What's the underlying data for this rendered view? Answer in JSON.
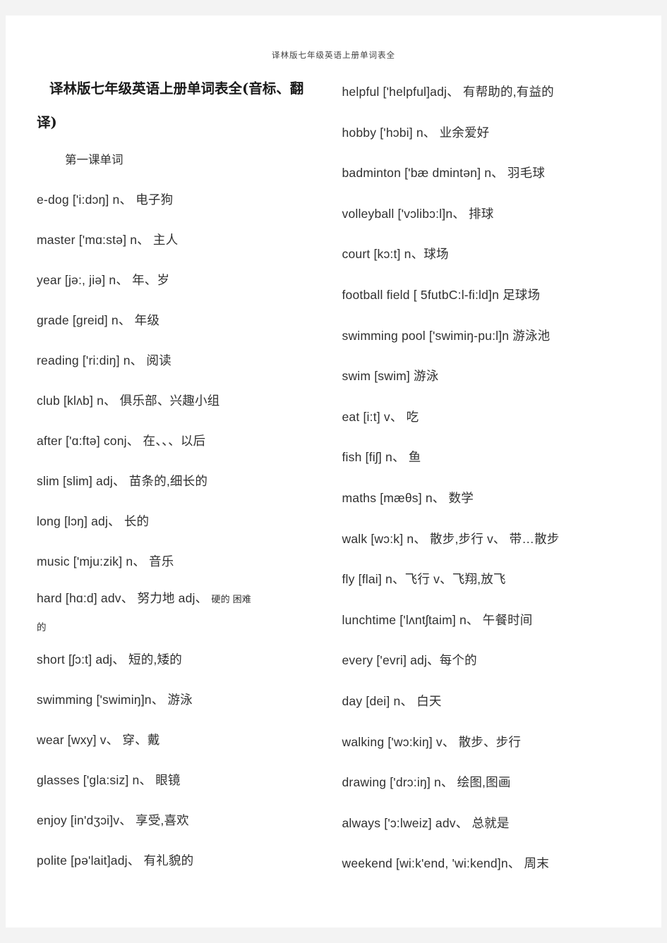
{
  "page": {
    "running_header": "译林版七年级英语上册单词表全",
    "title": "译林版七年级英语上册单词表全(音标、翻译)",
    "section_heading": "第一课单词"
  },
  "left_column": {
    "entries": [
      "e-dog ['i:dɔŋ] n、 电子狗",
      "master ['mɑ:stə] n、 主人",
      "year [jə:, jiə] n、 年、岁",
      "grade [greid] n、 年级",
      "reading ['ri:diŋ] n、 阅读",
      "club [klʌb] n、 俱乐部、兴趣小组",
      "after ['ɑ:ftə] conj、 在、、、以后",
      "slim [slim] adj、 苗条的,细长的",
      "long [lɔŋ] adj、 长的",
      "music ['mju:zik] n、 音乐"
    ],
    "hard_entry": {
      "main": "hard [hɑ:d] adv、 努力地 adj、 ",
      "tail": "硬的 困难",
      "continuation": "的"
    },
    "entries_after": [
      "short [ʃɔ:t] adj、 短的,矮的",
      "swimming ['swimiŋ]n、 游泳",
      "wear [wxy] v、 穿、戴",
      "glasses ['gla:siz] n、 眼镜",
      "enjoy [in'dʒɔi]v、 享受,喜欢",
      "polite [pə'lait]adj、 有礼貌的"
    ]
  },
  "right_column": {
    "entries": [
      "helpful ['helpful]adj、 有帮助的,有益的",
      "hobby ['hɔbi] n、 业余爱好",
      "badminton ['bæ dmintən] n、 羽毛球",
      "volleyball ['vɔlibɔ:l]n、 排球",
      "court [kɔ:t] n、球场",
      "football field [ 5futbC:l-fi:ld]n 足球场",
      "swimming pool ['swimiŋ-pu:l]n 游泳池",
      "swim [swim] 游泳",
      "eat [i:t] v、 吃",
      "fish [fiʃ] n、 鱼",
      "maths [mæθs] n、 数学",
      "walk [wɔ:k] n、 散步,步行 v、 带…散步",
      "fly [flai] n、飞行 v、飞翔,放飞",
      "lunchtime ['lʌntʃtaim] n、 午餐时间",
      "every ['evri] adj、每个的",
      "day [dei] n、 白天",
      "walking ['wɔ:kiŋ] v、 散步、步行",
      "drawing ['drɔ:iŋ] n、 绘图,图画",
      "always ['ɔ:lweiz] adv、 总就是",
      "weekend [wi:k'end, 'wi:kend]n、 周末"
    ]
  }
}
